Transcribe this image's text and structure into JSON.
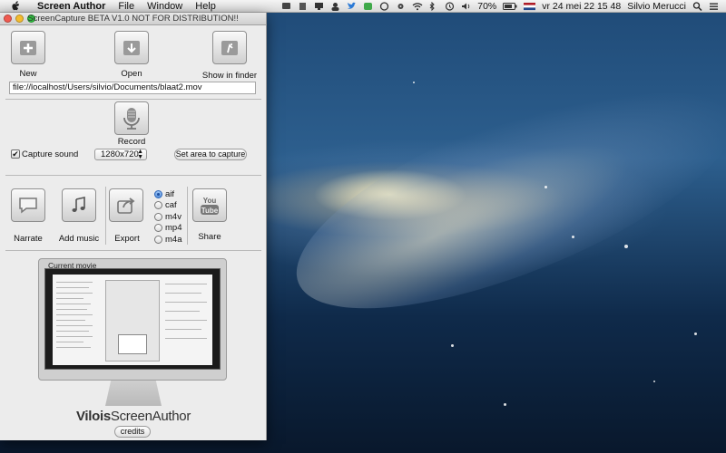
{
  "menubar": {
    "app_name": "Screen Author",
    "items": [
      "File",
      "Window",
      "Help"
    ],
    "status": {
      "battery": "70%",
      "datetime": "vr 24 mei   22 15 48",
      "user": "Silvio Merucci"
    }
  },
  "window": {
    "title": "ScreenCapture BETA V1.0 NOT FOR DISTRIBUTION!!",
    "toolbar": {
      "new_label": "New",
      "open_label": "Open",
      "show_in_finder_label": "Show in finder"
    },
    "path_value": "file://localhost/Users/silvio/Documents/blaat2.mov",
    "record": {
      "record_label": "Record",
      "capture_sound_label": "Capture sound",
      "capture_sound_checked": true,
      "resolution": "1280x720",
      "set_area_label": "Set area to capture"
    },
    "actions": {
      "narrate_label": "Narrate",
      "add_music_label": "Add music",
      "export_label": "Export",
      "share_label": "Share",
      "formats": [
        "aif",
        "caf",
        "m4v",
        "mp4",
        "m4a"
      ],
      "selected_format": "aif"
    },
    "preview": {
      "title": "Current movie",
      "brand_bold": "Vilois",
      "brand_rest": "ScreenAuthor",
      "credits_label": "credits"
    }
  },
  "colors": {
    "accent": "#2a64b8",
    "window_bg": "#ececec"
  }
}
